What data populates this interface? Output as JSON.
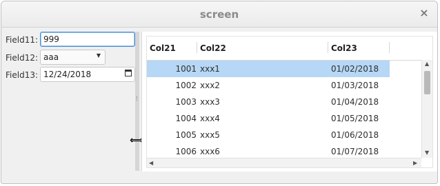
{
  "window": {
    "title": "screen",
    "close_glyph": "×"
  },
  "form": {
    "field11": {
      "label": "Field11:",
      "value": "999"
    },
    "field12": {
      "label": "Field12:",
      "value": "aaa"
    },
    "field13": {
      "label": "Field13:",
      "value": "12/24/2018"
    }
  },
  "table": {
    "columns": [
      "Col21",
      "Col22",
      "Col23"
    ],
    "rows": [
      [
        "1001",
        "xxx1",
        "01/02/2018"
      ],
      [
        "1002",
        "xxx2",
        "01/03/2018"
      ],
      [
        "1003",
        "xxx3",
        "01/04/2018"
      ],
      [
        "1004",
        "xxx4",
        "01/05/2018"
      ],
      [
        "1005",
        "xxx5",
        "01/06/2018"
      ],
      [
        "1006",
        "xxx6",
        "01/07/2018"
      ]
    ],
    "selected_row": 0
  },
  "colors": {
    "selection": "#b6d7f5",
    "focus_border": "#4a90d9"
  }
}
